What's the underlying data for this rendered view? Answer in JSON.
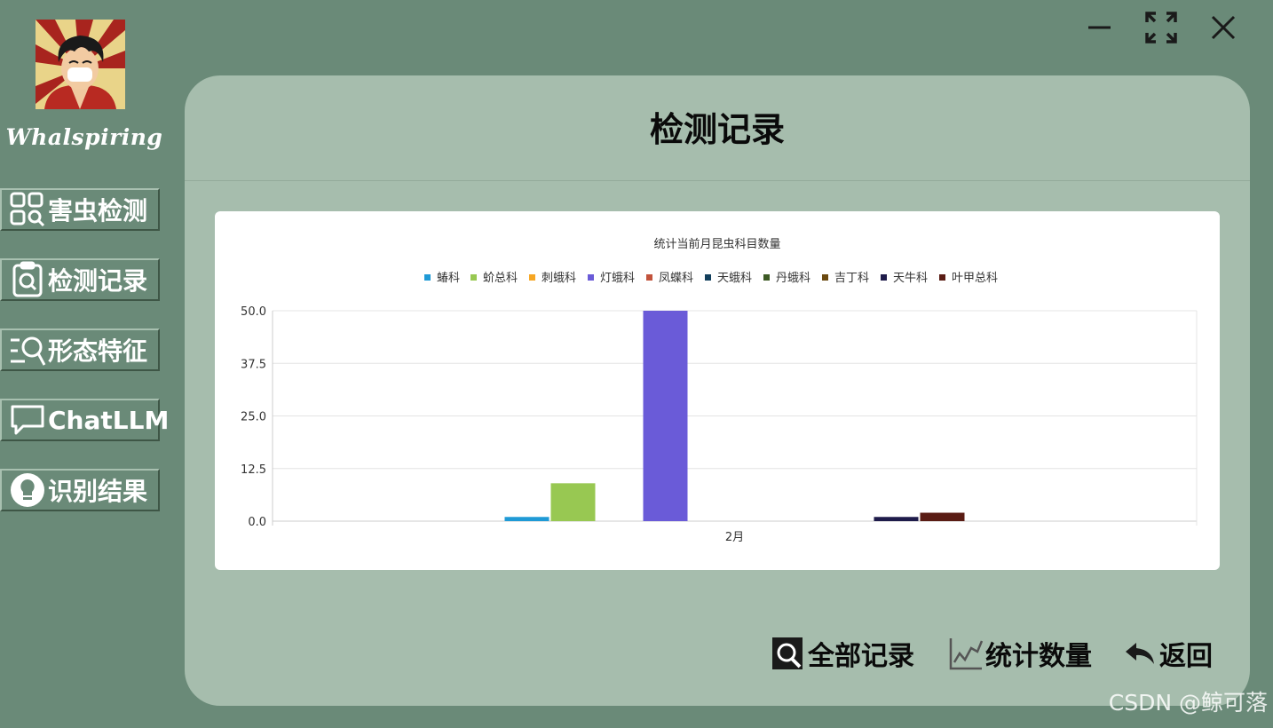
{
  "sidebar": {
    "avatar_icon": "straw-hat-avatar",
    "username": "Whalspiring",
    "items": [
      {
        "label": "害虫检测",
        "icon": "grid-search-icon"
      },
      {
        "label": "检测记录",
        "icon": "clipboard-search-icon"
      },
      {
        "label": "形态特征",
        "icon": "list-search-icon"
      },
      {
        "label": "ChatLLM",
        "icon": "chat-bubble-icon"
      },
      {
        "label": "识别结果",
        "icon": "lightbulb-icon"
      }
    ]
  },
  "window_controls": {
    "minimize_icon": "minimize-icon",
    "maximize_icon": "maximize-icon",
    "close_icon": "close-icon"
  },
  "panel": {
    "title": "检测记录"
  },
  "chart_data": {
    "type": "bar",
    "title": "统计当前月昆虫科目数量",
    "categories": [
      "2月"
    ],
    "series": [
      {
        "name": "蝽科",
        "color": "#1f9ad6",
        "values": [
          1
        ]
      },
      {
        "name": "蚧总科",
        "color": "#98c852",
        "values": [
          9
        ]
      },
      {
        "name": "刺蛾科",
        "color": "#f6a623",
        "values": [
          0
        ]
      },
      {
        "name": "灯蛾科",
        "color": "#6a5bd8",
        "values": [
          50
        ]
      },
      {
        "name": "凤蝶科",
        "color": "#c2533c",
        "values": [
          0
        ]
      },
      {
        "name": "天蛾科",
        "color": "#123f5c",
        "values": [
          0
        ]
      },
      {
        "name": "丹蛾科",
        "color": "#3d5a24",
        "values": [
          0
        ]
      },
      {
        "name": "吉丁科",
        "color": "#6b4a10",
        "values": [
          0
        ]
      },
      {
        "name": "天牛科",
        "color": "#1e1b4a",
        "values": [
          1
        ]
      },
      {
        "name": "叶甲总科",
        "color": "#5a1c14",
        "values": [
          2
        ]
      }
    ],
    "ylim": [
      0,
      50
    ],
    "yticks": [
      "0.0",
      "12.5",
      "25.0",
      "37.5",
      "50.0"
    ],
    "xlabel": "",
    "ylabel": "",
    "grid": true,
    "legend": "top-center"
  },
  "actions": {
    "all_records": {
      "label": "全部记录",
      "icon": "search-record-icon"
    },
    "statistics": {
      "label": "统计数量",
      "icon": "line-chart-icon"
    },
    "back": {
      "label": "返回",
      "icon": "back-arrow-icon"
    }
  },
  "watermark": "CSDN @鲸可落"
}
